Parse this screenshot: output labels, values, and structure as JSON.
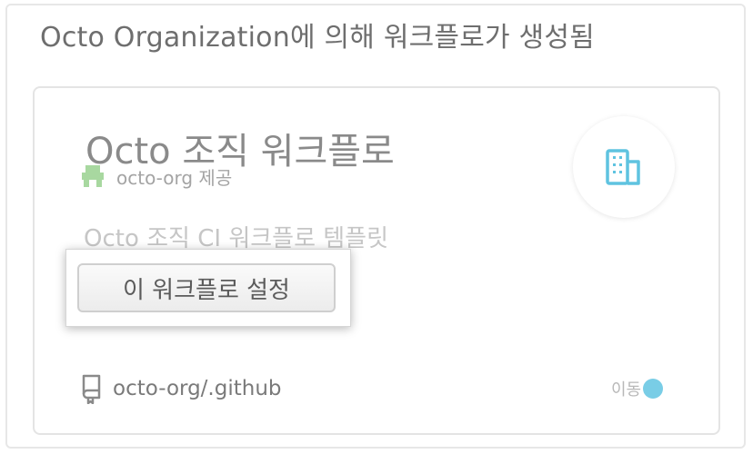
{
  "section": {
    "heading": "Octo Organization에 의해 워크플로가 생성됨"
  },
  "card": {
    "title": "Octo 조직 워크플로",
    "owner_text": "octo-org 제공",
    "description": "Octo 조직 CI 워크플로 템플릿",
    "setup_button_label": "이 워크플로 설정",
    "repo_link": "octo-org/.github",
    "language_label": "이동",
    "language_color": "#79cde6",
    "org_icon_color": "#5fc3e0",
    "owner_avatar_color": "#a8d8a0",
    "org_icon": "building-icon",
    "repo_icon": "repo-icon"
  }
}
